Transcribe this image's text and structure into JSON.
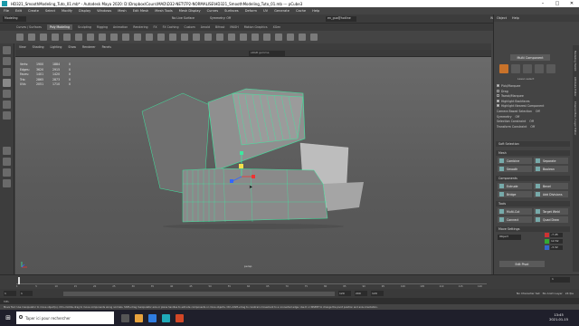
{
  "window": {
    "title": "HD321_SmoothModeling_Tuto_01.mb* - Autodesk Maya 2020: D:\\Dropbox\\Cours\\MAD\\D32-NET\\TP2-NORMALISE\\HD321_SmoothModeling_Tuto_01.mb --- pCube3",
    "minimize": "–",
    "maximize": "□",
    "close": "✕"
  },
  "menubar": {
    "items": [
      "File",
      "Edit",
      "Create",
      "Select",
      "Modify",
      "Display",
      "Windows",
      "Mesh",
      "Edit Mesh",
      "Mesh Tools",
      "Mesh Display",
      "Curves",
      "Surfaces",
      "Deform",
      "UV",
      "Generate",
      "Cache",
      "Help"
    ]
  },
  "statusline": {
    "menuset": "Modeling",
    "live_surface": "No Live Surface",
    "symmetry": "Symmetry: Off",
    "signin": "en_guo@hotline",
    "workspace_label": "Workspace :",
    "workspace": "Maya Classic"
  },
  "shelf": {
    "tabs": [
      "Curves / Surfaces",
      "Poly Modeling",
      "Sculpting",
      "Rigging",
      "Animation",
      "Rendering",
      "FX",
      "FX Caching",
      "Custom",
      "Arnold",
      "Bifrost",
      "MASH",
      "Motion Graphics",
      "XGen"
    ],
    "active_tab": "Poly Modeling"
  },
  "viewport": {
    "menu": [
      "View",
      "Shading",
      "Lighting",
      "Show",
      "Renderer",
      "Panels"
    ],
    "camera_field": "sRGB gamma",
    "hud": {
      "rows": [
        {
          "label": "Verts:",
          "a": "1900",
          "b": "1884",
          "c": "0"
        },
        {
          "label": "Edges:",
          "a": "3620",
          "b": "2915",
          "c": "0"
        },
        {
          "label": "Faces:",
          "a": "1401",
          "b": "1420",
          "c": "0"
        },
        {
          "label": "Tris:",
          "a": "2865",
          "b": "2873",
          "c": "0"
        },
        {
          "label": "UVs:",
          "a": "2051",
          "b": "1710",
          "c": "0"
        }
      ]
    },
    "camera_label": "persp"
  },
  "attribute_panel": {
    "tabs": [
      "Object",
      "Help"
    ],
    "multi_component": "Multi Component",
    "sub_label": "Lasso select",
    "options": [
      {
        "label": "Pick/Marquee",
        "checked": true
      },
      {
        "label": "Drag",
        "checked": false
      },
      {
        "label": "Tweak/Marquee",
        "checked": false
      },
      {
        "label": "Highlight Backfaces",
        "checked": true
      },
      {
        "label": "Highlight Nearest Component",
        "checked": true
      },
      {
        "label": "Camera Based Selection",
        "value": "Off"
      },
      {
        "label": "Symmetry",
        "value": "Off"
      },
      {
        "label": "Selection Constraint",
        "value": "Off"
      },
      {
        "label": "Transform Constraint",
        "value": "Off"
      }
    ],
    "sections": {
      "soft_selection": "Soft Selection",
      "mesh": "Mesh",
      "components": "Components",
      "tools": "Tools",
      "move_settings": "Move Settings"
    },
    "mesh_buttons": [
      "Combine",
      "Separate",
      "Smooth",
      "Boolean"
    ],
    "component_buttons": [
      "Extrude",
      "Bevel",
      "Bridge",
      "Add Divisions"
    ],
    "tool_buttons": [
      "Multi-Cut",
      "Target Weld",
      "Connect",
      "Quad Draw"
    ],
    "move_axis": "Object",
    "move_values": [
      "-7.45",
      "12.52",
      "-3.32"
    ],
    "edit_pivot": "Edit Pivot"
  },
  "side_tabs": [
    "Modeling Toolkit",
    "Attribute Editor",
    "Channel Box / Layer Editor"
  ],
  "timeline": {
    "ticks": [
      "1",
      "5",
      "10",
      "15",
      "20",
      "25",
      "30",
      "35",
      "40",
      "45",
      "50",
      "55",
      "60",
      "65",
      "70",
      "75",
      "80",
      "85",
      "90",
      "95",
      "100",
      "105",
      "110",
      "115",
      "120"
    ],
    "current_frame": "1"
  },
  "range": {
    "start": "1",
    "start_inner": "1",
    "end_inner": "120",
    "end": "200",
    "end2": "120",
    "char_set": "No Character Set",
    "anim_layer": "No Anim Layer",
    "fps": "24 fps"
  },
  "cmd": {
    "label": "MEL"
  },
  "helpline": {
    "text": "Move Tool: Use manipulator to move object(s). Ctrl+middle-drag to move components along normals. Shift+drag manipulator axis or plane handles to extrude components or clone objects. Ctrl+Shift+drag to constrain movement to a connected edge. Use D or INSERT to change the pivot position and axis orientation."
  },
  "taskbar": {
    "search_placeholder": "Taper ici pour rechercher",
    "time": "13:45",
    "date": "2021-01-15"
  },
  "colors": {
    "accent": "#c8722a",
    "selection": "#3ee8a0",
    "maya_teal": "#1fa9b8"
  }
}
